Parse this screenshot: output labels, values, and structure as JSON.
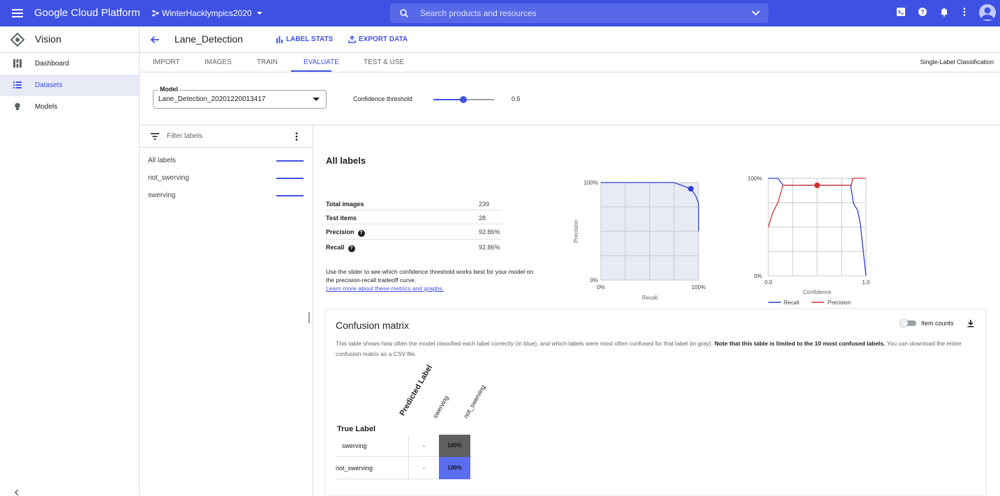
{
  "topbar": {
    "brand": "Google Cloud Platform",
    "project": "WinterHacklympics2020",
    "search_placeholder": "Search products and resources"
  },
  "sidebar": {
    "title": "Vision",
    "items": [
      {
        "label": "Dashboard",
        "icon": "dashboard-icon"
      },
      {
        "label": "Datasets",
        "icon": "list-icon"
      },
      {
        "label": "Models",
        "icon": "lightbulb-icon"
      }
    ]
  },
  "header": {
    "title": "Lane_Detection",
    "label_stats": "LABEL STATS",
    "export_data": "EXPORT DATA"
  },
  "tabs": [
    "IMPORT",
    "IMAGES",
    "TRAIN",
    "EVALUATE",
    "TEST & USE"
  ],
  "active_tab": "EVALUATE",
  "classification_type": "Single-Label Classification",
  "model": {
    "label": "Model",
    "value": "Lane_Detection_20201220013417"
  },
  "confidence": {
    "label": "Confidence threshold",
    "value": "0.5"
  },
  "labels_panel": {
    "filter_placeholder": "Filter labels",
    "items": [
      "All labels",
      "not_swerving",
      "swerving"
    ]
  },
  "metrics": {
    "title": "All labels",
    "rows": [
      {
        "key": "Total images",
        "value": "239"
      },
      {
        "key": "Test items",
        "value": "28"
      },
      {
        "key": "Precision",
        "value": "92.86%"
      },
      {
        "key": "Recall",
        "value": "92.86%"
      }
    ],
    "description": "Use the slider to see which confidence threshold works best for your model on the precision-recall tradeoff curve.",
    "link": "Learn more about these metrics and graphs."
  },
  "pr_chart": {
    "y_top": "100%",
    "y_bottom": "0%",
    "x_left": "0%",
    "x_right": "100%",
    "xlabel": "Recall",
    "ylabel": "Precision"
  },
  "conf_chart": {
    "y_top": "100%",
    "y_bottom": "0%",
    "x_left": "0.0",
    "x_right": "1.0",
    "xlabel": "Confidence",
    "legend_recall": "Recall",
    "legend_precision": "Precision"
  },
  "confusion": {
    "title": "Confusion matrix",
    "item_counts": "Item counts",
    "blurb_a": "This table shows how often the model classified each label correctly (in blue), and which labels were most often confused for that label (in gray). ",
    "blurb_b": "Note that this table is limited to the 10 most confused labels.",
    "blurb_c": " You can download the entire confusion matrix as a CSV file.",
    "predicted_label": "Predicted Label",
    "true_label": "True Label",
    "columns": [
      "swerving",
      "not_swerving"
    ],
    "rows": [
      {
        "label": "swerving",
        "dash": "-",
        "value": "100%"
      },
      {
        "label": "not_swerving",
        "dash": "-",
        "value": "100%"
      }
    ]
  },
  "colors": {
    "accent": "#3f51e3",
    "recall": "#2f3cd0",
    "precision": "#d32f2f",
    "cell_gray": "#5f5f5f",
    "cell_blue": "#5b6ef0"
  }
}
